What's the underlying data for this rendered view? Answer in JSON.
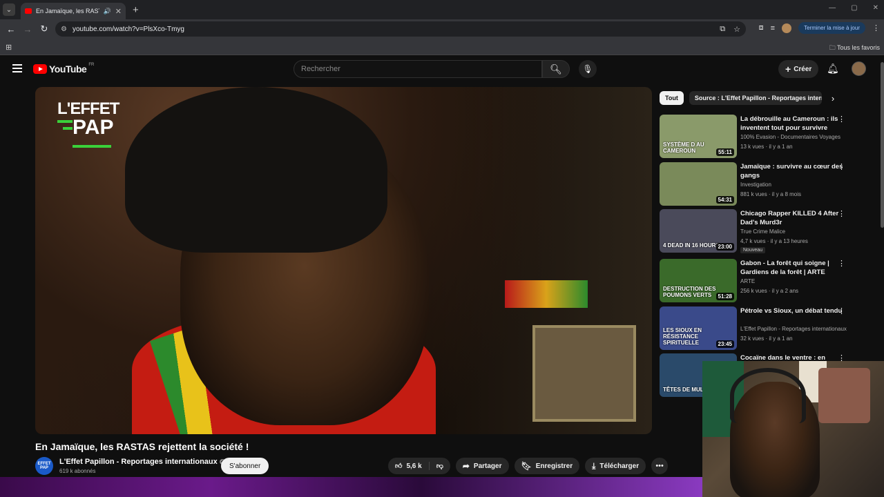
{
  "browser": {
    "tab_title": "En Jamaïque, les RASTAS re",
    "tab_close": "✕",
    "new_tab": "+",
    "url": "youtube.com/watch?v=PlsXco-Tmyg",
    "update_label": "Terminer la mise à jour",
    "bookmarks_all": "Tous les favoris",
    "window_controls": [
      "—",
      "▢",
      "✕"
    ]
  },
  "header": {
    "logo_text": "YouTube",
    "logo_region": "FR",
    "search_placeholder": "Rechercher",
    "create_label": "Créer"
  },
  "video": {
    "brand_line1": "L'EFFET",
    "brand_line2": "PAP",
    "title": "En Jamaïque, les RASTAS rejettent la société !",
    "channel_name": "L'Effet Papillon - Reportages internationaux",
    "channel_avatar_text": "EFFET PAP",
    "subscribers": "619 k abonnés",
    "subscribe_label": "S'abonner",
    "likes": "5,6 k",
    "share_label": "Partager",
    "save_label": "Enregistrer",
    "download_label": "Télécharger"
  },
  "sidebar": {
    "chips": [
      "Tout",
      "Source : L'Effet Papillon - Reportages internationaux"
    ],
    "recommendations": [
      {
        "title": "La débrouille au Cameroun : ils inventent tout pour survivre",
        "channel": "100% Evasion - Documentaires Voyages",
        "meta": "13 k vues · il y a 1 an",
        "duration": "55:11",
        "overlay": "SYSTÈME D AU CAMEROUN",
        "badge": "",
        "thumb_color": "#8a9a6a"
      },
      {
        "title": "Jamaïque : survivre au cœur des gangs",
        "channel": "Investigation",
        "meta": "881 k vues · il y a 8 mois",
        "duration": "54:31",
        "overlay": "",
        "badge": "",
        "thumb_color": "#7a8a5a"
      },
      {
        "title": "Chicago Rapper KILLED 4 After Dad's Murd3r",
        "channel": "True Crime Malice",
        "meta": "4,7 k vues · il y a 13 heures",
        "duration": "23:00",
        "overlay": "4 DEAD IN 16 HOURS",
        "badge": "Nouveau",
        "thumb_color": "#4a4a5a"
      },
      {
        "title": "Gabon - La forêt qui soigne | Gardiens de la forêt | ARTE",
        "channel": "ARTE",
        "meta": "256 k vues · il y a 2 ans",
        "duration": "51:28",
        "overlay": "DESTRUCTION DES POUMONS VERTS",
        "badge": "",
        "thumb_color": "#3a6a2a"
      },
      {
        "title": "Pétrole vs Sioux, un débat tendu",
        "channel": "L'Effet Papillon - Reportages internationaux",
        "meta": "32 k vues · il y a 1 an",
        "duration": "23:45",
        "overlay": "LES SIOUX EN RÉSISTANCE SPIRITUELLE",
        "badge": "",
        "thumb_color": "#3a4a8a"
      },
      {
        "title": "Cocaïne dans le ventre : en",
        "channel": "",
        "meta": "",
        "duration": "",
        "overlay": "TÊTES DE MULES",
        "badge": "",
        "thumb_color": "#2a4a6a"
      }
    ]
  },
  "colors": {
    "accent": "#ff0000",
    "bg": "#0f0f0f",
    "chip_bg": "#272727"
  }
}
